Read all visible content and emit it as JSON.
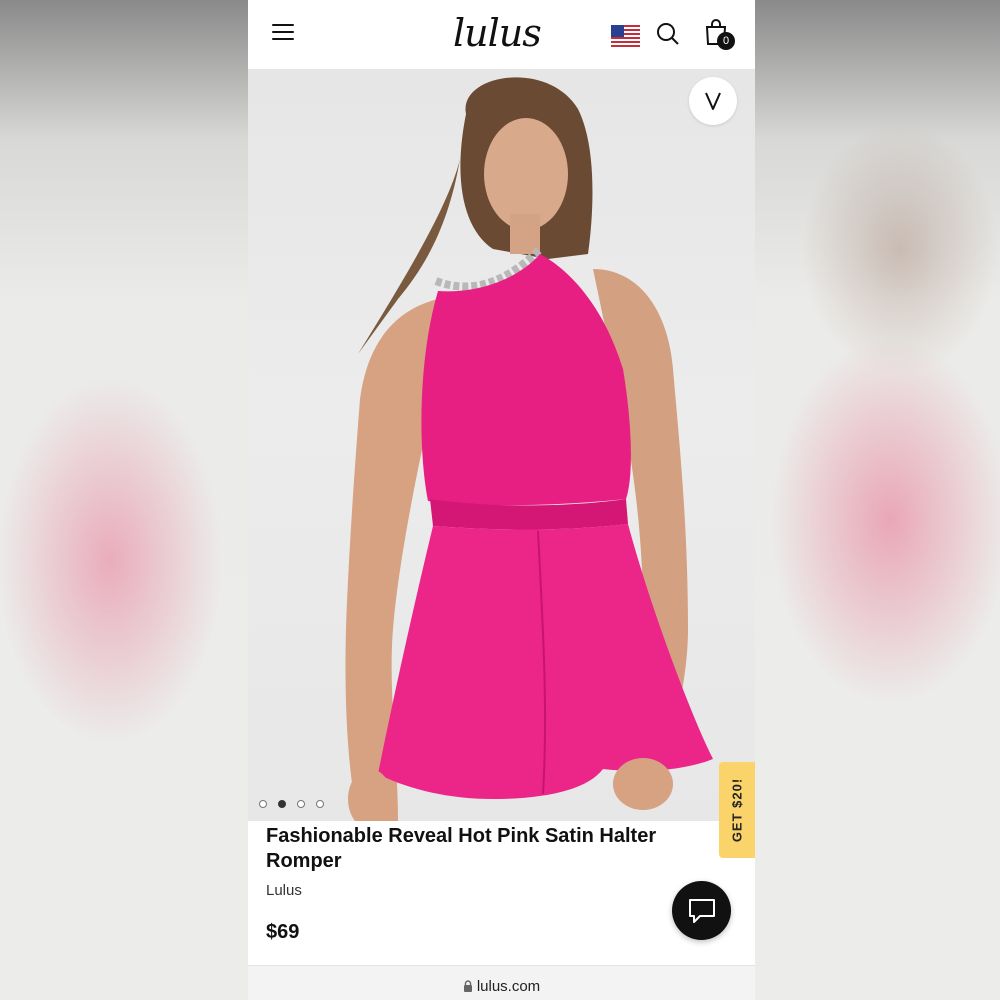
{
  "header": {
    "logo_text": "lulus",
    "bag_count": "0",
    "icons": [
      "menu-icon",
      "us-flag-icon",
      "search-icon",
      "shopping-bag-icon"
    ]
  },
  "gallery": {
    "image_count": 4,
    "active_index": 1,
    "image_description_alt": "Model in hot pink satin halter romper with chain necklace"
  },
  "promo": {
    "label": "GET $20!"
  },
  "product": {
    "title": "Fashionable Reveal Hot Pink Satin Halter Romper",
    "brand": "Lulus",
    "price": "$69"
  },
  "browser": {
    "url": "lulus.com"
  },
  "colors": {
    "promo_bg": "#fbd36b",
    "romper_pink": "#ec1f86",
    "chat_bg": "#111111"
  }
}
